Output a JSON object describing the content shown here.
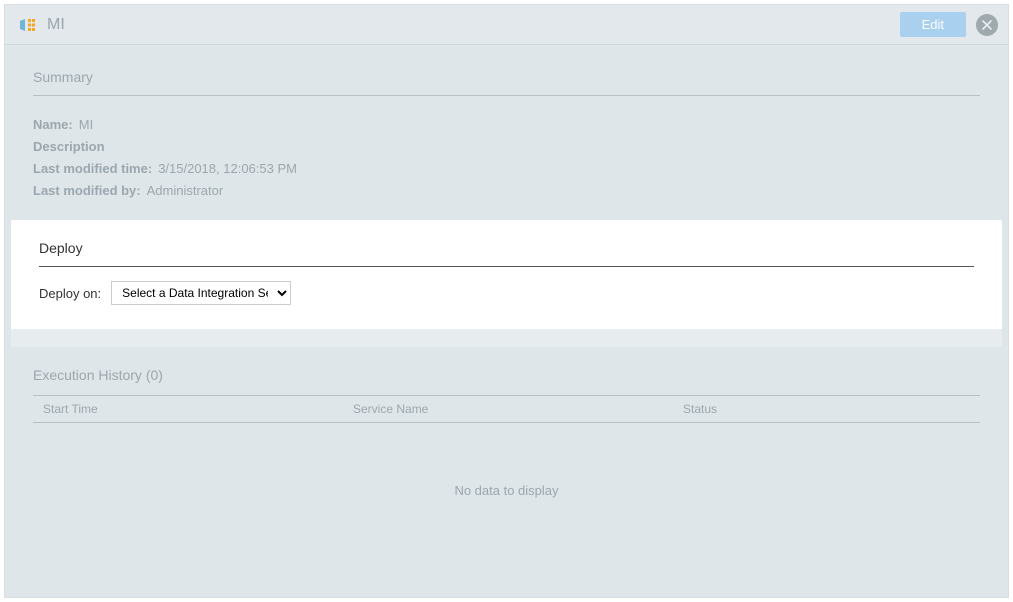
{
  "header": {
    "title": "MI",
    "edit_label": "Edit"
  },
  "summary": {
    "heading": "Summary",
    "name_label": "Name:",
    "name_value": "MI",
    "description_label": "Description",
    "description_value": "",
    "last_modified_time_label": "Last modified time:",
    "last_modified_time_value": "3/15/2018, 12:06:53 PM",
    "last_modified_by_label": "Last modified by:",
    "last_modified_by_value": "Administrator"
  },
  "deploy": {
    "heading": "Deploy",
    "deploy_on_label": "Deploy on:",
    "select_placeholder": "Select a Data Integration Ser"
  },
  "history": {
    "heading": "Execution History (0)",
    "columns": {
      "start_time": "Start Time",
      "service_name": "Service Name",
      "status": "Status"
    },
    "empty_message": "No data to display"
  }
}
